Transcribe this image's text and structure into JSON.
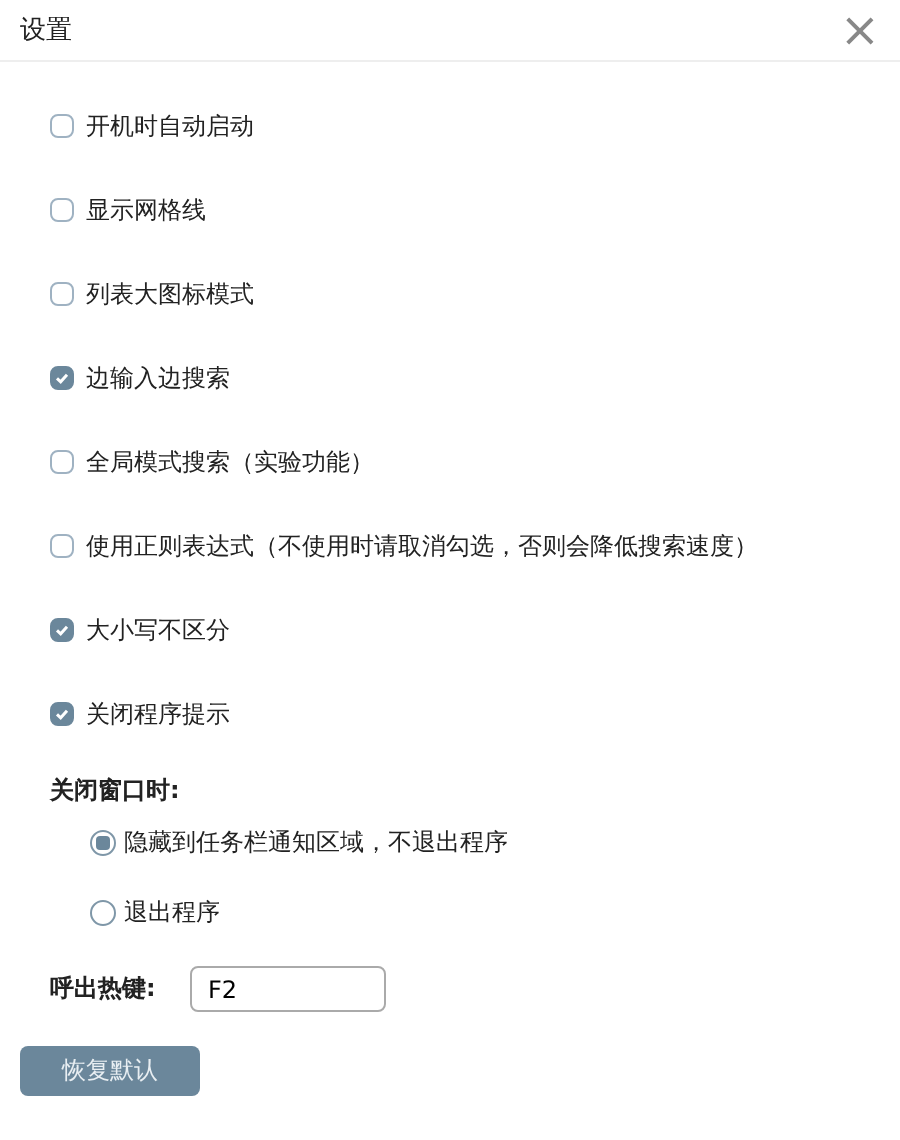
{
  "window": {
    "title": "设置",
    "close": "×"
  },
  "options": [
    {
      "label": "开机时自动启动",
      "checked": false
    },
    {
      "label": "显示网格线",
      "checked": false
    },
    {
      "label": "列表大图标模式",
      "checked": false
    },
    {
      "label": "边输入边搜索",
      "checked": true
    },
    {
      "label": "全局模式搜索（实验功能）",
      "checked": false
    },
    {
      "label": "使用正则表达式（不使用时请取消勾选，否则会降低搜索速度）",
      "checked": false
    },
    {
      "label": "大小写不区分",
      "checked": true
    },
    {
      "label": "关闭程序提示",
      "checked": true
    }
  ],
  "close_behavior": {
    "label": "关闭窗口时:",
    "choices": [
      {
        "label": "隐藏到任务栏通知区域，不退出程序",
        "selected": true
      },
      {
        "label": "退出程序",
        "selected": false
      }
    ]
  },
  "hotkey": {
    "label": "呼出热键:",
    "value": "F2"
  },
  "buttons": [
    "恢复默认"
  ]
}
